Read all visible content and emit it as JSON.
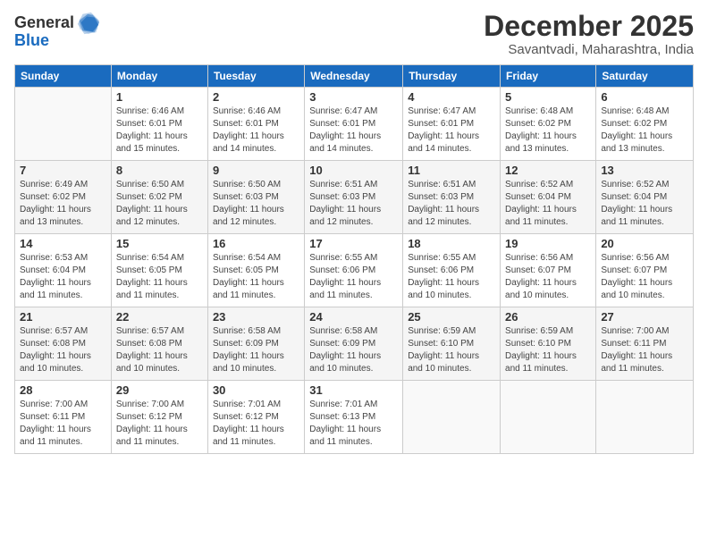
{
  "logo": {
    "general": "General",
    "blue": "Blue"
  },
  "title": "December 2025",
  "subtitle": "Savantvadi, Maharashtra, India",
  "days_header": [
    "Sunday",
    "Monday",
    "Tuesday",
    "Wednesday",
    "Thursday",
    "Friday",
    "Saturday"
  ],
  "weeks": [
    [
      {
        "day": "",
        "info": ""
      },
      {
        "day": "1",
        "info": "Sunrise: 6:46 AM\nSunset: 6:01 PM\nDaylight: 11 hours\nand 15 minutes."
      },
      {
        "day": "2",
        "info": "Sunrise: 6:46 AM\nSunset: 6:01 PM\nDaylight: 11 hours\nand 14 minutes."
      },
      {
        "day": "3",
        "info": "Sunrise: 6:47 AM\nSunset: 6:01 PM\nDaylight: 11 hours\nand 14 minutes."
      },
      {
        "day": "4",
        "info": "Sunrise: 6:47 AM\nSunset: 6:01 PM\nDaylight: 11 hours\nand 14 minutes."
      },
      {
        "day": "5",
        "info": "Sunrise: 6:48 AM\nSunset: 6:02 PM\nDaylight: 11 hours\nand 13 minutes."
      },
      {
        "day": "6",
        "info": "Sunrise: 6:48 AM\nSunset: 6:02 PM\nDaylight: 11 hours\nand 13 minutes."
      }
    ],
    [
      {
        "day": "7",
        "info": "Sunrise: 6:49 AM\nSunset: 6:02 PM\nDaylight: 11 hours\nand 13 minutes."
      },
      {
        "day": "8",
        "info": "Sunrise: 6:50 AM\nSunset: 6:02 PM\nDaylight: 11 hours\nand 12 minutes."
      },
      {
        "day": "9",
        "info": "Sunrise: 6:50 AM\nSunset: 6:03 PM\nDaylight: 11 hours\nand 12 minutes."
      },
      {
        "day": "10",
        "info": "Sunrise: 6:51 AM\nSunset: 6:03 PM\nDaylight: 11 hours\nand 12 minutes."
      },
      {
        "day": "11",
        "info": "Sunrise: 6:51 AM\nSunset: 6:03 PM\nDaylight: 11 hours\nand 12 minutes."
      },
      {
        "day": "12",
        "info": "Sunrise: 6:52 AM\nSunset: 6:04 PM\nDaylight: 11 hours\nand 11 minutes."
      },
      {
        "day": "13",
        "info": "Sunrise: 6:52 AM\nSunset: 6:04 PM\nDaylight: 11 hours\nand 11 minutes."
      }
    ],
    [
      {
        "day": "14",
        "info": "Sunrise: 6:53 AM\nSunset: 6:04 PM\nDaylight: 11 hours\nand 11 minutes."
      },
      {
        "day": "15",
        "info": "Sunrise: 6:54 AM\nSunset: 6:05 PM\nDaylight: 11 hours\nand 11 minutes."
      },
      {
        "day": "16",
        "info": "Sunrise: 6:54 AM\nSunset: 6:05 PM\nDaylight: 11 hours\nand 11 minutes."
      },
      {
        "day": "17",
        "info": "Sunrise: 6:55 AM\nSunset: 6:06 PM\nDaylight: 11 hours\nand 11 minutes."
      },
      {
        "day": "18",
        "info": "Sunrise: 6:55 AM\nSunset: 6:06 PM\nDaylight: 11 hours\nand 10 minutes."
      },
      {
        "day": "19",
        "info": "Sunrise: 6:56 AM\nSunset: 6:07 PM\nDaylight: 11 hours\nand 10 minutes."
      },
      {
        "day": "20",
        "info": "Sunrise: 6:56 AM\nSunset: 6:07 PM\nDaylight: 11 hours\nand 10 minutes."
      }
    ],
    [
      {
        "day": "21",
        "info": "Sunrise: 6:57 AM\nSunset: 6:08 PM\nDaylight: 11 hours\nand 10 minutes."
      },
      {
        "day": "22",
        "info": "Sunrise: 6:57 AM\nSunset: 6:08 PM\nDaylight: 11 hours\nand 10 minutes."
      },
      {
        "day": "23",
        "info": "Sunrise: 6:58 AM\nSunset: 6:09 PM\nDaylight: 11 hours\nand 10 minutes."
      },
      {
        "day": "24",
        "info": "Sunrise: 6:58 AM\nSunset: 6:09 PM\nDaylight: 11 hours\nand 10 minutes."
      },
      {
        "day": "25",
        "info": "Sunrise: 6:59 AM\nSunset: 6:10 PM\nDaylight: 11 hours\nand 10 minutes."
      },
      {
        "day": "26",
        "info": "Sunrise: 6:59 AM\nSunset: 6:10 PM\nDaylight: 11 hours\nand 11 minutes."
      },
      {
        "day": "27",
        "info": "Sunrise: 7:00 AM\nSunset: 6:11 PM\nDaylight: 11 hours\nand 11 minutes."
      }
    ],
    [
      {
        "day": "28",
        "info": "Sunrise: 7:00 AM\nSunset: 6:11 PM\nDaylight: 11 hours\nand 11 minutes."
      },
      {
        "day": "29",
        "info": "Sunrise: 7:00 AM\nSunset: 6:12 PM\nDaylight: 11 hours\nand 11 minutes."
      },
      {
        "day": "30",
        "info": "Sunrise: 7:01 AM\nSunset: 6:12 PM\nDaylight: 11 hours\nand 11 minutes."
      },
      {
        "day": "31",
        "info": "Sunrise: 7:01 AM\nSunset: 6:13 PM\nDaylight: 11 hours\nand 11 minutes."
      },
      {
        "day": "",
        "info": ""
      },
      {
        "day": "",
        "info": ""
      },
      {
        "day": "",
        "info": ""
      }
    ]
  ]
}
